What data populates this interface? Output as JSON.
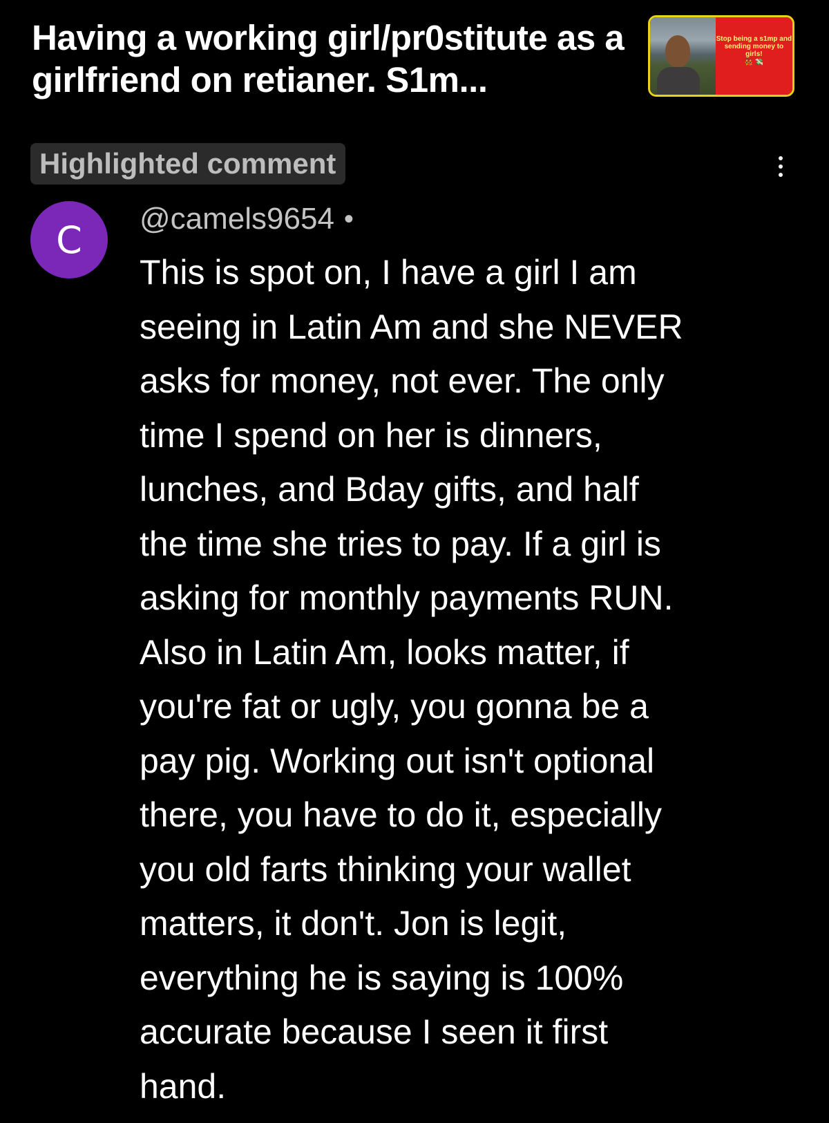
{
  "header": {
    "title": "Having a working girl/pr0stitute as a girlfriend on retianer. S1m...",
    "thumbnail": {
      "text": "Stop being a s1mp and sending money to girls!",
      "emoji": "👯 💸",
      "border_color": "#e8d21a",
      "panel_color": "#e01e1e"
    }
  },
  "comment": {
    "badge": "Highlighted comment",
    "more_icon": "more-vertical-icon",
    "avatar_letter": "C",
    "avatar_color": "#7b28b8",
    "author": "@camels9654",
    "separator": "•",
    "text": "This is spot on, I have a girl I am\nseeing in Latin Am and she NEVER\nasks for money, not ever.  The only\ntime I spend on her is dinners,\nlunches, and Bday gifts, and half\nthe time she tries to pay.  If a girl is\nasking for monthly payments RUN.\nAlso in Latin Am, looks matter, if\nyou're fat or ugly, you gonna be a\npay pig.  Working out isn't optional\nthere, you have to do it, especially\nyou old farts thinking your wallet\nmatters, it don't.  Jon is legit,\neverything he is saying is 100%\naccurate because I seen it first\nhand."
  }
}
